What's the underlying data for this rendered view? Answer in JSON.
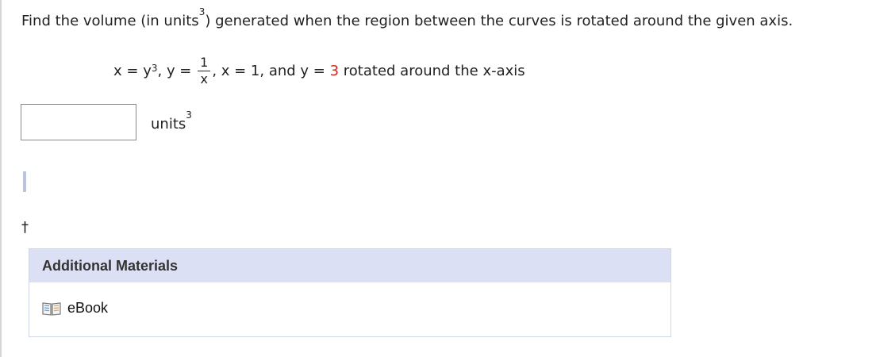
{
  "question": {
    "text_before": "Find the volume (in units",
    "exponent": "3",
    "text_after": ") generated when the region between the curves is rotated around the given axis."
  },
  "math": {
    "x_eq": "x = ",
    "y_var": "y",
    "y_exp": "3",
    "y_sep": ", ",
    "y_eq": "y = ",
    "frac_num": "1",
    "frac_den": "x",
    "after_frac": ", x = 1, and ",
    "y_eq2": "y = ",
    "red_value": "3",
    "axis_text": " rotated around the x-axis"
  },
  "answer": {
    "value": "",
    "units_label": "units",
    "units_exp": "3"
  },
  "footnote_marker": "†",
  "additional_materials": {
    "title": "Additional Materials",
    "ebook_label": "eBook"
  }
}
